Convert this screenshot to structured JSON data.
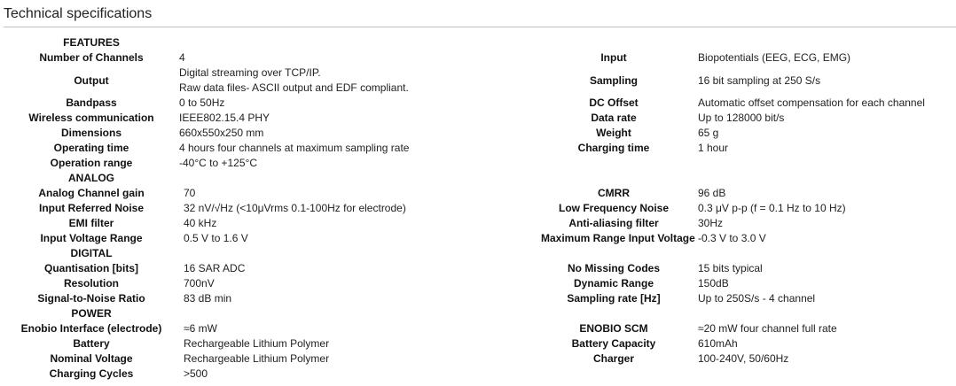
{
  "title": "Technical specifications",
  "sections": {
    "features": "FEATURES",
    "analog": "ANALOG",
    "digital": "DIGITAL",
    "power": "POWER"
  },
  "features": {
    "channels_label": "Number of Channels",
    "channels_value": "4",
    "input_label": "Input",
    "input_value": "Biopotentials (EEG, ECG, EMG)",
    "output_label": "Output",
    "output_value_1": "Digital streaming over TCP/IP.",
    "output_value_2": "Raw data files- ASCII output and EDF compliant.",
    "sampling_label": "Sampling",
    "sampling_value": "16 bit sampling at 250 S/s",
    "bandpass_label": "Bandpass",
    "bandpass_value": "0 to 50Hz",
    "dcoffset_label": "DC Offset",
    "dcoffset_value": "Automatic offset compensation for each channel",
    "wireless_label": "Wireless communication",
    "wireless_value": "IEEE802.15.4 PHY",
    "datarate_label": "Data rate",
    "datarate_value": "Up to 128000 bit/s",
    "dimensions_label": "Dimensions",
    "dimensions_value": "660x550x250 mm",
    "weight_label": "Weight",
    "weight_value": "65 g",
    "optime_label": "Operating time",
    "optime_value": "4 hours four channels at maximum sampling rate",
    "charging_label": "Charging time",
    "charging_value": "1 hour",
    "oprange_label": "Operation range",
    "oprange_value": "-40°C to +125°C"
  },
  "analog": {
    "gain_label": "Analog Channel gain",
    "gain_value": "70",
    "cmrr_label": "CMRR",
    "cmrr_value": "96 dB",
    "irn_label": "Input Referred Noise",
    "irn_value": "32 nV/√Hz (<10μVrms 0.1-100Hz for electrode)",
    "lfn_label": "Low Frequency Noise",
    "lfn_value": "0.3 μV p-p (f = 0.1 Hz to 10 Hz)",
    "emi_label": "EMI filter",
    "emi_value": "40 kHz",
    "aa_label": "Anti-aliasing filter",
    "aa_value": "30Hz",
    "ivr_label": "Input Voltage Range",
    "ivr_value": "0.5 V to 1.6 V",
    "mriv_label": "Maximum Range Input Voltage",
    "mriv_value": "-0.3 V to 3.0 V"
  },
  "digital": {
    "quant_label": "Quantisation [bits]",
    "quant_value": "16 SAR ADC",
    "nmc_label": "No Missing Codes",
    "nmc_value": "15 bits typical",
    "res_label": "Resolution",
    "res_value": "700nV",
    "dr_label": "Dynamic Range",
    "dr_value": "150dB",
    "snr_label": "Signal-to-Noise Ratio",
    "snr_value": "83 dB min",
    "sr_label": "Sampling rate [Hz]",
    "sr_value": "Up to 250S/s - 4 channel"
  },
  "power": {
    "interface_label": "Enobio Interface (electrode)",
    "interface_value": "≈6 mW",
    "scm_label": "ENOBIO SCM",
    "scm_value": "≈20 mW four channel full rate",
    "battery_label": "Battery",
    "battery_value": "Rechargeable Lithium Polymer",
    "capacity_label": "Battery Capacity",
    "capacity_value": "610mAh",
    "voltage_label": "Nominal Voltage",
    "voltage_value": "Rechargeable Lithium Polymer",
    "charger_label": "Charger",
    "charger_value": "100-240V, 50/60Hz",
    "cycles_label": "Charging Cycles",
    "cycles_value": ">500"
  }
}
